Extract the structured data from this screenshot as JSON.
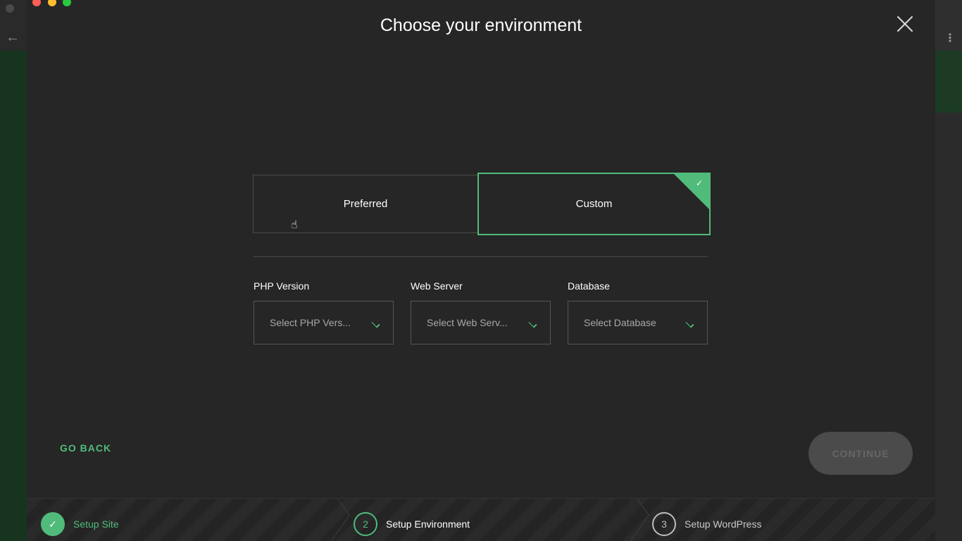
{
  "modal": {
    "title": "Choose your environment",
    "close_icon": "close-icon"
  },
  "environment_options": [
    {
      "label": "Preferred",
      "selected": false
    },
    {
      "label": "Custom",
      "selected": true
    }
  ],
  "fields": {
    "php": {
      "label": "PHP Version",
      "placeholder": "Select PHP Vers..."
    },
    "web_server": {
      "label": "Web Server",
      "placeholder": "Select Web Serv..."
    },
    "database": {
      "label": "Database",
      "placeholder": "Select Database"
    }
  },
  "actions": {
    "go_back": "GO BACK",
    "continue": "CONTINUE"
  },
  "steps": [
    {
      "number": "1",
      "label": "Setup Site",
      "status": "complete"
    },
    {
      "number": "2",
      "label": "Setup Environment",
      "status": "current"
    },
    {
      "number": "3",
      "label": "Setup WordPress",
      "status": "upcoming"
    }
  ],
  "colors": {
    "accent": "#51bb7b",
    "modal_bg": "#262626",
    "continue_disabled_bg": "#4b4b4b"
  }
}
